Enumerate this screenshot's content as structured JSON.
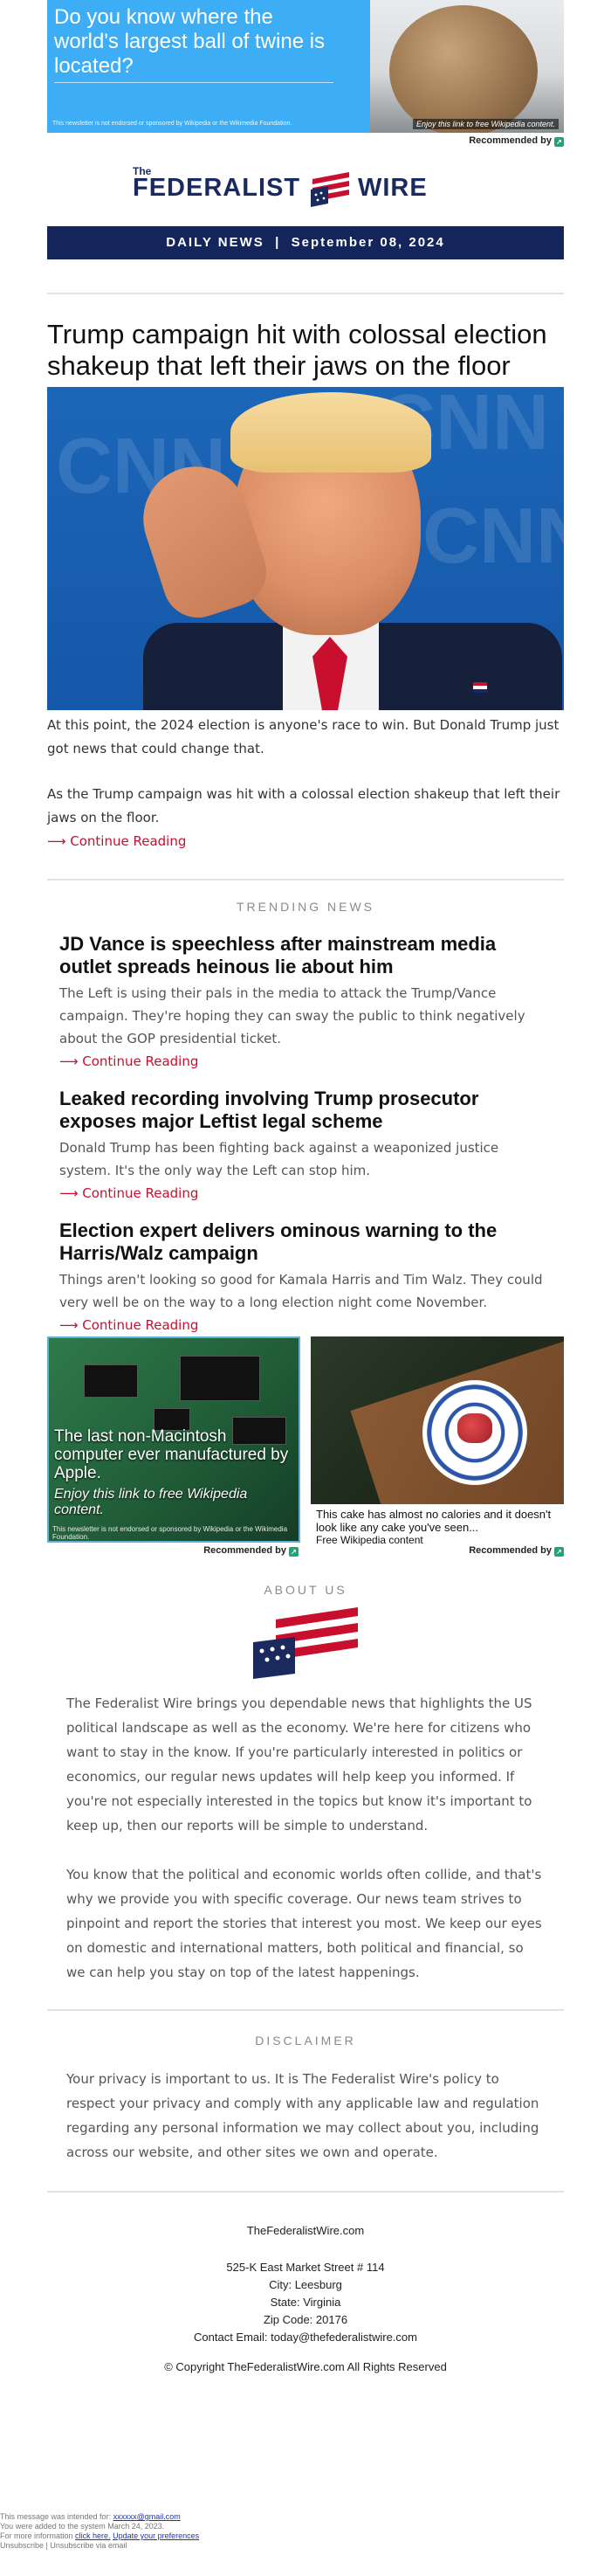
{
  "top_ad": {
    "headline": "Do you know where the world's largest ball of twine is located?",
    "disclaimer": "This newsletter is not endorsed or sponsored by Wikipedia or the Wikimedia Foundation.",
    "photo_caption": "Enjoy this link to free Wikipedia content.",
    "recommended": "Recommended by"
  },
  "brand": {
    "the": "The",
    "name_left": "FEDERALIST",
    "name_right": "WIRE"
  },
  "date_band": {
    "label": "DAILY NEWS",
    "separator": "|",
    "date": "September 08, 2024"
  },
  "main_story": {
    "title": "Trump campaign hit with colossal election shakeup that left their jaws on the floor",
    "p1": "At this point, the 2024 election is anyone's race to win. But Donald Trump just got news that could change that.",
    "p2": "As the Trump campaign was hit with a colossal election shakeup that left their jaws on the floor.",
    "continue": "⟶ Continue Reading"
  },
  "trending": {
    "heading": "TRENDING NEWS",
    "items": [
      {
        "title": "JD Vance is speechless after mainstream media outlet spreads heinous lie about him",
        "body": "The Left is using their pals in the media to attack the Trump/Vance campaign. They're hoping they can sway the public to think negatively about the GOP presidential ticket.",
        "continue": "⟶ Continue Reading"
      },
      {
        "title": "Leaked recording involving Trump prosecutor exposes major Leftist legal scheme",
        "body": "Donald Trump has been fighting back against a weaponized justice system. It's the only way the Left can stop him.",
        "continue": "⟶ Continue Reading"
      },
      {
        "title": "Election expert delivers ominous warning to the Harris/Walz campaign",
        "body": "Things aren't looking so good for Kamala Harris and Tim Walz. They could very well be on the way to a long election night come November.",
        "continue": "⟶ Continue Reading"
      }
    ]
  },
  "native_ads": {
    "left": {
      "headline": "The last non-Macintosh computer ever manufactured by Apple.",
      "sub": "Enjoy this link to free Wikipedia content.",
      "disclaimer": "This newsletter is not endorsed or sponsored by Wikipedia or the Wikimedia Foundation.",
      "recommended": "Recommended by"
    },
    "right": {
      "headline": "This cake has almost no calories and it doesn't look like any cake you've seen...",
      "source": "Free Wikipedia content",
      "recommended": "Recommended by"
    }
  },
  "about": {
    "heading": "ABOUT US",
    "p1": "The Federalist Wire brings you dependable news that highlights the US political landscape as well as the economy. We're here for citizens who want to stay in the know. If you're particularly interested in politics or economics, our regular news updates will help keep you informed. If you're not especially interested in the topics but know it's important to keep up, then our reports will be simple to understand.",
    "p2": "You know that the political and economic worlds often collide, and that's why we provide you with specific coverage. Our news team strives to pinpoint and report the stories that interest you most. We keep our eyes on domestic and international matters, both political and financial, so we can help you stay on top of the latest happenings."
  },
  "disclaimer": {
    "heading": "DISCLAIMER",
    "body": "Your privacy is important to us. It is The Federalist Wire's policy to respect your privacy and comply with any applicable law and regulation regarding any personal information we may collect about you, including across our website, and other sites we own and operate."
  },
  "footer": {
    "site": "TheFederalistWire.com",
    "street": "525-K East Market Street # 114",
    "city": "City: Leesburg",
    "state": "State: Virginia",
    "zip": "Zip Code: 20176",
    "email": "Contact Email: today@thefederalistwire.com",
    "copyright": "© Copyright TheFederalistWire.com All Rights Reserved"
  },
  "meta": {
    "intended_prefix": "This message was intended for:",
    "intended_email": "xxxxxx@gmail.com",
    "added": "You were added to the system March 24, 2023.",
    "info_prefix": "For more information",
    "click_here": "click here.",
    "update_prefs": "Update your preferences",
    "unsubscribe": "Unsubscribe | Unsubscribe via email"
  },
  "colors": {
    "navy": "#13255a",
    "accent_red": "#c8102e",
    "ad_blue": "#3daef5"
  }
}
